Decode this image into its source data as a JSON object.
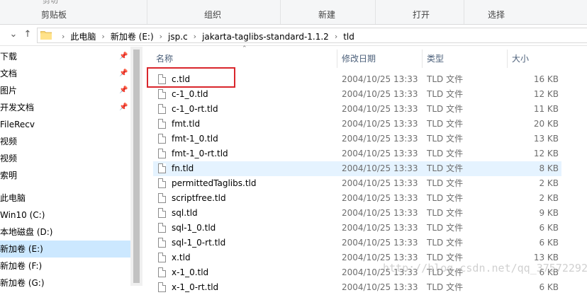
{
  "ribbon": {
    "cut_label": "剪切",
    "groups": [
      "剪贴板",
      "组织",
      "新建",
      "打开",
      "选择"
    ]
  },
  "address": {
    "crumbs": [
      "此电脑",
      "新加卷 (E:)",
      "jsp.c",
      "jakarta-taglibs-standard-1.1.2",
      "tld"
    ]
  },
  "sidebar": {
    "items": [
      {
        "label": "下载",
        "pinned": true
      },
      {
        "label": "文档",
        "pinned": true
      },
      {
        "label": "图片",
        "pinned": true
      },
      {
        "label": "开发文档",
        "pinned": true
      },
      {
        "label": "FileRecv",
        "pinned": false
      },
      {
        "label": "视频",
        "pinned": false
      },
      {
        "label": "视频",
        "pinned": false
      },
      {
        "label": "索明",
        "pinned": false
      },
      {
        "label": "此电脑",
        "pinned": false
      },
      {
        "label": "Win10 (C:)",
        "pinned": false
      },
      {
        "label": "本地磁盘 (D:)",
        "pinned": false
      },
      {
        "label": "新加卷 (E:)",
        "pinned": false,
        "selected": true
      },
      {
        "label": "新加卷 (F:)",
        "pinned": false
      },
      {
        "label": "新加卷 (G:)",
        "pinned": false
      }
    ]
  },
  "columns": {
    "name": "名称",
    "date": "修改日期",
    "type": "类型",
    "size": "大小"
  },
  "files": [
    {
      "name": "c.tld",
      "date": "2004/10/25 13:33",
      "type": "TLD 文件",
      "size": "16 KB"
    },
    {
      "name": "c-1_0.tld",
      "date": "2004/10/25 13:33",
      "type": "TLD 文件",
      "size": "12 KB"
    },
    {
      "name": "c-1_0-rt.tld",
      "date": "2004/10/25 13:33",
      "type": "TLD 文件",
      "size": "11 KB"
    },
    {
      "name": "fmt.tld",
      "date": "2004/10/25 13:33",
      "type": "TLD 文件",
      "size": "20 KB"
    },
    {
      "name": "fmt-1_0.tld",
      "date": "2004/10/25 13:33",
      "type": "TLD 文件",
      "size": "13 KB"
    },
    {
      "name": "fmt-1_0-rt.tld",
      "date": "2004/10/25 13:33",
      "type": "TLD 文件",
      "size": "12 KB"
    },
    {
      "name": "fn.tld",
      "date": "2004/10/25 13:33",
      "type": "TLD 文件",
      "size": "8 KB",
      "highlighted": true
    },
    {
      "name": "permittedTaglibs.tld",
      "date": "2004/10/25 13:33",
      "type": "TLD 文件",
      "size": "2 KB"
    },
    {
      "name": "scriptfree.tld",
      "date": "2004/10/25 13:33",
      "type": "TLD 文件",
      "size": "2 KB"
    },
    {
      "name": "sql.tld",
      "date": "2004/10/25 13:33",
      "type": "TLD 文件",
      "size": "9 KB"
    },
    {
      "name": "sql-1_0.tld",
      "date": "2004/10/25 13:33",
      "type": "TLD 文件",
      "size": "6 KB"
    },
    {
      "name": "sql-1_0-rt.tld",
      "date": "2004/10/25 13:33",
      "type": "TLD 文件",
      "size": "6 KB"
    },
    {
      "name": "x.tld",
      "date": "2004/10/25 13:33",
      "type": "TLD 文件",
      "size": "13 KB"
    },
    {
      "name": "x-1_0.tld",
      "date": "2004/10/25 13:33",
      "type": "TLD 文件",
      "size": "6 KB"
    },
    {
      "name": "x-1_0-rt.tld",
      "date": "2004/10/25 13:33",
      "type": "TLD 文件",
      "size": "6 KB"
    }
  ],
  "watermark": "http://blog.csdn.net/qq_37572292",
  "colors": {
    "highlight_row": "#e5f3ff",
    "selected_nav": "#cce8ff",
    "annotation": "#d9262c"
  }
}
